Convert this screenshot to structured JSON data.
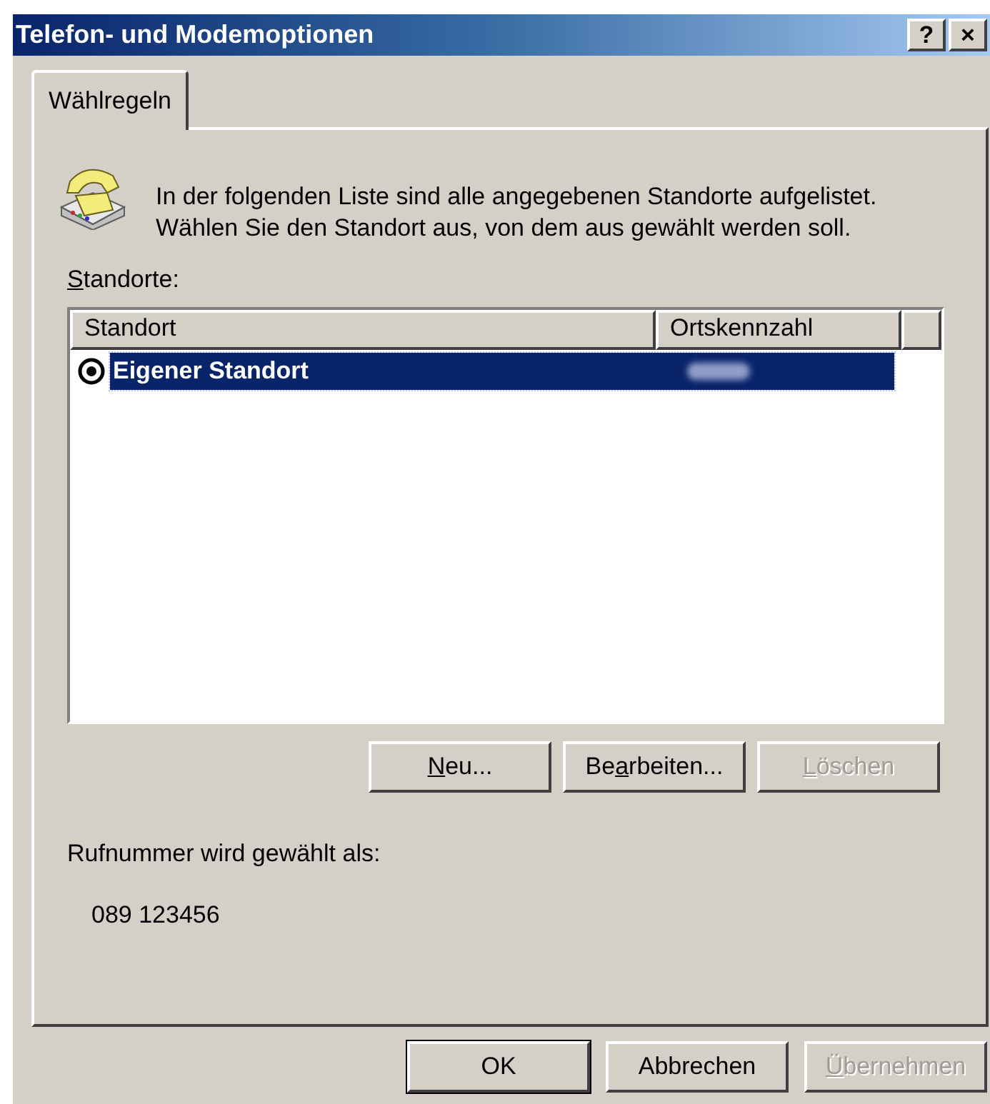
{
  "window": {
    "title": "Telefon- und Modemoptionen",
    "title_buttons": [
      "?",
      "×"
    ]
  },
  "tabs": [
    {
      "label": "Wählregeln",
      "selected": true
    }
  ],
  "intro": "In der folgenden Liste sind alle angegebenen Standorte aufgelistet. Wählen Sie den Standort aus, von dem aus gewählt werden soll.",
  "list_label": {
    "key": "S",
    "post": "tandorte:"
  },
  "table": {
    "columns": [
      "Standort",
      "Ortskennzahl"
    ],
    "rows": [
      {
        "name": "Eigener Standort",
        "selected": true,
        "area_code_blurred": true
      }
    ]
  },
  "list_buttons": [
    {
      "key": "N",
      "post": "eu...",
      "disabled": false,
      "default": false
    },
    {
      "pre": "Be",
      "key": "a",
      "post": "rbeiten...",
      "disabled": false,
      "default": false
    },
    {
      "key": "L",
      "post": "öschen",
      "disabled": true,
      "default": false
    }
  ],
  "dial_label": "Rufnummer wird gewählt als:",
  "dial_number": "089 123456",
  "dialog_buttons": [
    {
      "pre": "OK",
      "disabled": false,
      "default": true
    },
    {
      "pre": "Abbrechen",
      "disabled": false,
      "default": false
    },
    {
      "key": "Ü",
      "post": "bernehmen",
      "disabled": true,
      "default": false
    }
  ]
}
